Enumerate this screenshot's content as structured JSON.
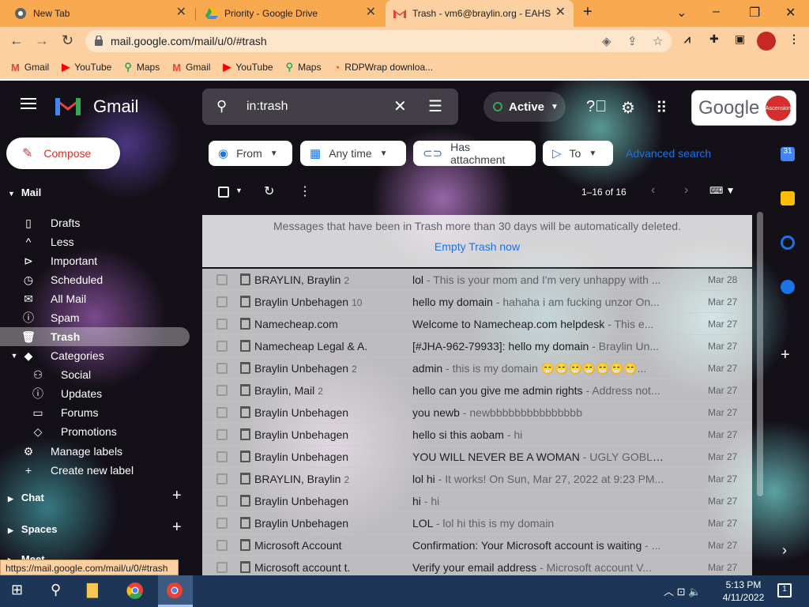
{
  "browser": {
    "tabs": [
      {
        "label": "New Tab",
        "icon": "chrome-icon"
      },
      {
        "label": "Priority - Google Drive",
        "icon": "drive-icon"
      },
      {
        "label": "Trash - vm6@braylin.org - EAHS",
        "icon": "gmail-icon"
      }
    ],
    "url": "mail.google.com/mail/u/0/#trash",
    "bookmarks": [
      "Gmail",
      "YouTube",
      "Maps",
      "Gmail",
      "YouTube",
      "Maps",
      "RDPWrap downloa..."
    ],
    "status_url": "https://mail.google.com/mail/u/0/#trash"
  },
  "gmail": {
    "brand": "Gmail",
    "search_query": "in:trash",
    "status": "Active",
    "account_logo": "Google",
    "account_badge": "Ascension",
    "compose": "Compose",
    "filters": [
      "From",
      "Any time",
      "Has attachment",
      "To"
    ],
    "advanced_search": "Advanced search",
    "page_info": "1–16 of 16",
    "notice": "Messages that have been in Trash more than 30 days will be automatically deleted.",
    "empty_trash": "Empty Trash now",
    "nav": {
      "mail_section": "Mail",
      "items": [
        "Drafts",
        "Less",
        "Important",
        "Scheduled",
        "All Mail",
        "Spam",
        "Trash",
        "Categories"
      ],
      "categories": [
        "Social",
        "Updates",
        "Forums",
        "Promotions"
      ],
      "manage": "Manage labels",
      "create": "Create new label",
      "chat": "Chat",
      "spaces": "Spaces",
      "meet": "Meet"
    },
    "emails": [
      {
        "sender": "BRAYLIN, Braylin",
        "count": "2",
        "subject": "lol",
        "snippet": " - This is your mom and I'm very unhappy with ...",
        "date": "Mar 28"
      },
      {
        "sender": "Braylin Unbehagen",
        "count": "10",
        "subject": "hello my domain",
        "snippet": " - hahaha i am fucking unzor On...",
        "date": "Mar 27"
      },
      {
        "sender": "Namecheap.com",
        "count": "",
        "subject": "Welcome to Namecheap.com helpdesk",
        "snippet": " - This e...",
        "date": "Mar 27"
      },
      {
        "sender": "Namecheap Legal & A.",
        "count": "",
        "subject": "[#JHA-962-79933]: hello my domain",
        "snippet": " - Braylin Un...",
        "date": "Mar 27"
      },
      {
        "sender": "Braylin Unbehagen",
        "count": "2",
        "subject": "admin",
        "snippet": " - this is my domain 😁😁😁😁😁😁😁...",
        "date": "Mar 27"
      },
      {
        "sender": "Braylin, Mail",
        "count": "2",
        "subject": "hello can you give me admin rights",
        "snippet": " - Address not...",
        "date": "Mar 27"
      },
      {
        "sender": "Braylin Unbehagen",
        "count": "",
        "subject": "you newb",
        "snippet": " - newbbbbbbbbbbbbbbb",
        "date": "Mar 27"
      },
      {
        "sender": "Braylin Unbehagen",
        "count": "",
        "subject": "hello si this aobam",
        "snippet": " - hi",
        "date": "Mar 27"
      },
      {
        "sender": "Braylin Unbehagen",
        "count": "",
        "subject": "YOU WILL NEVER BE A WOMAN",
        "snippet": " - UGLY GOBLIN ...",
        "date": "Mar 27"
      },
      {
        "sender": "BRAYLIN, Braylin",
        "count": "2",
        "subject": "lol hi",
        "snippet": " - It works! On Sun, Mar 27, 2022 at 9:23 PM...",
        "date": "Mar 27"
      },
      {
        "sender": "Braylin Unbehagen",
        "count": "",
        "subject": "hi",
        "snippet": " - hi",
        "date": "Mar 27"
      },
      {
        "sender": "Braylin Unbehagen",
        "count": "",
        "subject": "LOL",
        "snippet": " - lol hi this is my domain",
        "date": "Mar 27"
      },
      {
        "sender": "Microsoft Account",
        "count": "",
        "subject": "Confirmation: Your Microsoft account is waiting",
        "snippet": " - ...",
        "date": "Mar 27"
      },
      {
        "sender": "Microsoft account t.",
        "count": "",
        "subject": "Verify your email address",
        "snippet": " - Microsoft account V...",
        "date": "Mar 27"
      }
    ]
  },
  "taskbar": {
    "time": "5:13 PM",
    "date": "4/11/2022"
  }
}
